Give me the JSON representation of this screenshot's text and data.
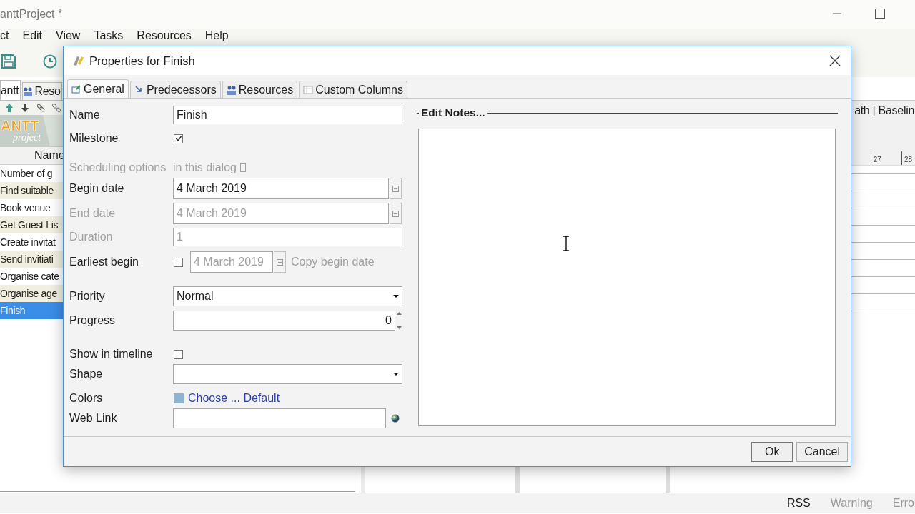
{
  "app": {
    "title": "anttProject *",
    "menu": [
      "ct",
      "Edit",
      "View",
      "Tasks",
      "Resources",
      "Help"
    ],
    "tabs": [
      {
        "label": "antt",
        "selected": true
      },
      {
        "label": "Reso",
        "selected": false
      }
    ],
    "logo": {
      "text": "ANTT",
      "subtext": "project"
    },
    "tree": {
      "header": "Name",
      "rows": [
        {
          "name": "Number of g",
          "selected": false
        },
        {
          "name": "Find suitable",
          "selected": false
        },
        {
          "name": "Book venue",
          "selected": false
        },
        {
          "name": "Get Guest Lis",
          "selected": false
        },
        {
          "name": "Create invitat",
          "selected": false
        },
        {
          "name": "Send invitiati",
          "selected": false
        },
        {
          "name": "Organise cate",
          "selected": false
        },
        {
          "name": "Organise age",
          "selected": false
        },
        {
          "name": "Finish",
          "selected": true
        }
      ]
    },
    "chart": {
      "toolbar": "ath | Baselin",
      "ticks": [
        "27",
        "28"
      ]
    },
    "status_bar": [
      {
        "label": "RSS",
        "disabled": false
      },
      {
        "label": "Warning",
        "disabled": true
      },
      {
        "label": "Erro",
        "disabled": true
      }
    ]
  },
  "dialog": {
    "title": "Properties for Finish",
    "tabs": [
      {
        "label": "General",
        "selected": true
      },
      {
        "label": "Predecessors",
        "selected": false
      },
      {
        "label": "Resources",
        "selected": false
      },
      {
        "label": "Custom Columns",
        "selected": false
      }
    ],
    "fields": [
      {
        "kind": "text",
        "label": "Name",
        "value": "Finish",
        "disabled": false
      },
      {
        "kind": "checkbox",
        "label": "Milestone",
        "checked": true
      },
      {
        "kind": "note",
        "label": "Scheduling options",
        "text": "in this dialog",
        "disabled": true
      },
      {
        "kind": "date",
        "label": "Begin date",
        "value": "4 March 2019",
        "disabled": false
      },
      {
        "kind": "date",
        "label": "End date",
        "value": "4 March 2019",
        "disabled": true
      },
      {
        "kind": "text",
        "label": "Duration",
        "value": "1",
        "disabled": true
      },
      {
        "kind": "earliest",
        "label": "Earliest begin",
        "checked": false,
        "value": "4 March 2019",
        "link": "Copy begin date",
        "disabled": true
      },
      {
        "kind": "select",
        "label": "Priority",
        "value": "Normal"
      },
      {
        "kind": "spinner",
        "label": "Progress",
        "value": "0"
      },
      {
        "kind": "checkbox",
        "label": "Show in timeline",
        "checked": false
      },
      {
        "kind": "select",
        "label": "Shape"
      },
      {
        "kind": "color",
        "label": "Colors",
        "link": "Choose ... Default"
      },
      {
        "kind": "url",
        "label": "Web Link"
      }
    ],
    "notes": {
      "legend": "Edit Notes..."
    },
    "buttons": [
      "Ok",
      "Cancel"
    ]
  }
}
